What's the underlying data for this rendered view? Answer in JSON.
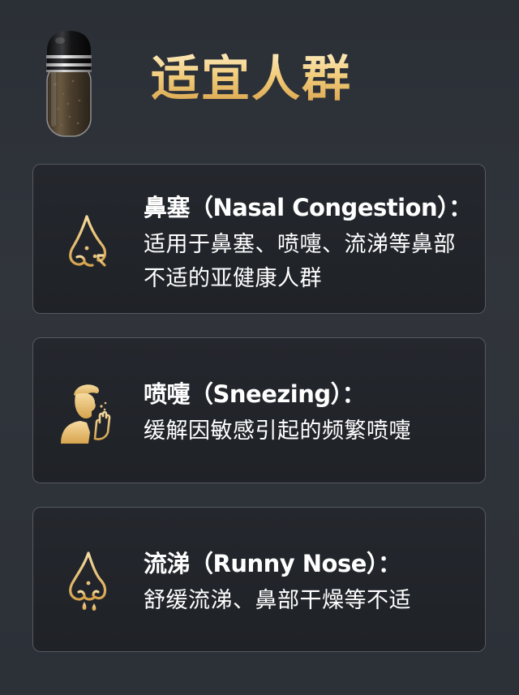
{
  "title": "适宜人群",
  "accent_color": "#e3b562",
  "cards": [
    {
      "icon": "nose-alert-icon",
      "heading": "鼻塞（Nasal Congestion）：",
      "description": "适用于鼻塞、喷嚏、流涕等鼻部不适的亚健康人群"
    },
    {
      "icon": "sneezing-person-icon",
      "heading": "喷嚏（Sneezing）：",
      "description": "缓解因敏感引起的频繁喷嚏"
    },
    {
      "icon": "runny-nose-icon",
      "heading": "流涕（Runny Nose）：",
      "description": "舒缓流涕、鼻部干燥等不适"
    }
  ]
}
